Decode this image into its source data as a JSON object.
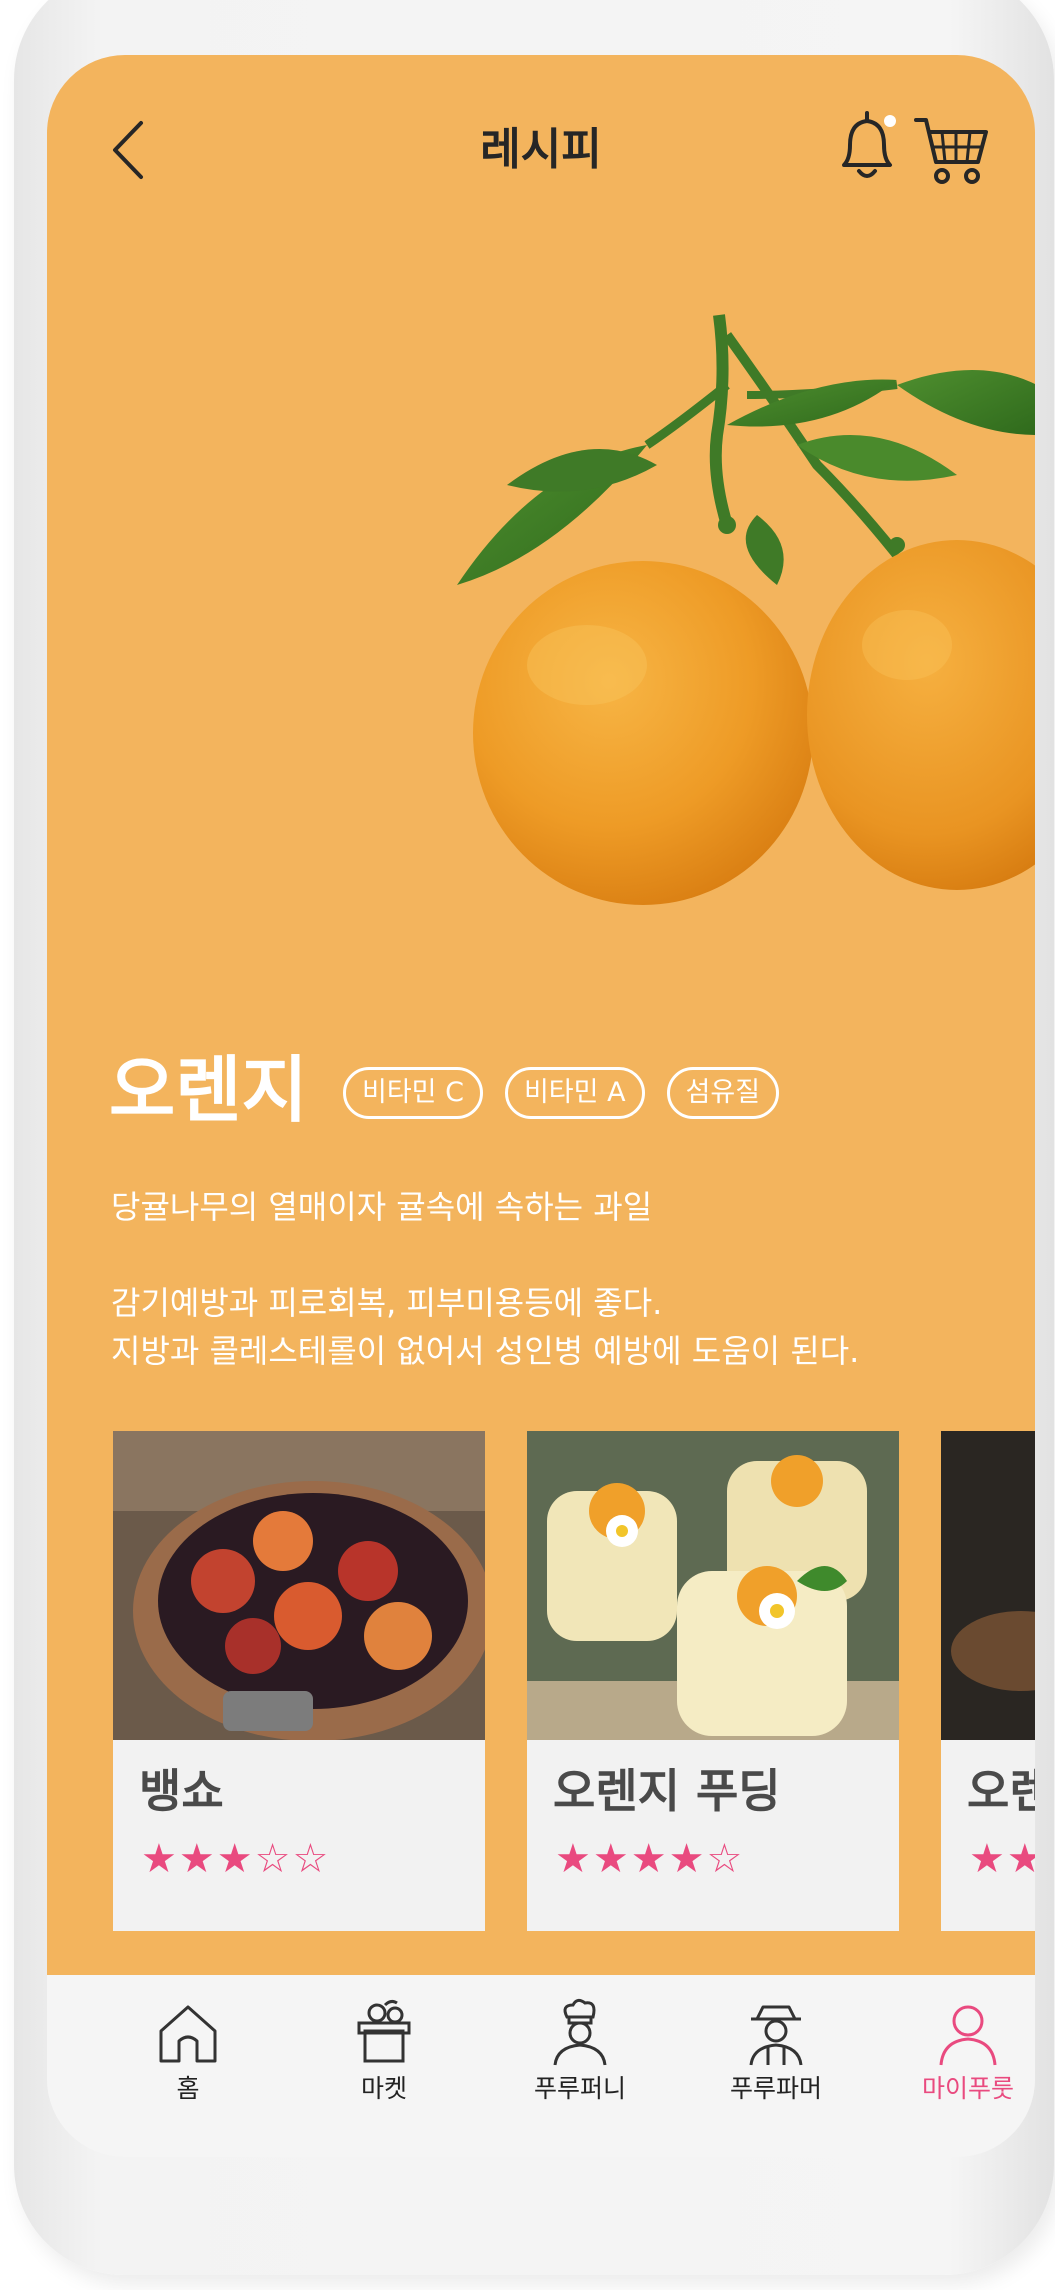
{
  "header": {
    "title": "레시피"
  },
  "fruit": {
    "name": "오렌지",
    "tags": [
      "비타민 C",
      "비타민 A",
      "섬유질"
    ],
    "description_line1": "당귤나무의 열매이자 귤속에 속하는 과일",
    "description_line2": "감기예방과 피로회복, 피부미용등에 좋다.",
    "description_line3": "지방과 콜레스테롤이 없어서 성인병 예방에 도움이 된다."
  },
  "recipes": [
    {
      "name": "뱅쇼",
      "rating": 3,
      "stars": "★★★☆☆"
    },
    {
      "name": "오렌지 푸딩",
      "rating": 4,
      "stars": "★★★★☆"
    },
    {
      "name": "오렌",
      "rating": 2,
      "stars": "★★"
    }
  ],
  "nav": {
    "items": [
      {
        "label": "홈",
        "icon": "home-icon"
      },
      {
        "label": "마켓",
        "icon": "market-basket-icon"
      },
      {
        "label": "푸루퍼니",
        "icon": "chef-icon"
      },
      {
        "label": "푸루파머",
        "icon": "farmer-icon"
      },
      {
        "label": "마이푸룻",
        "icon": "profile-icon"
      }
    ],
    "active_index": 4
  },
  "colors": {
    "background": "#f3b45d",
    "accent": "#e94a7f",
    "title_text": "#262626"
  }
}
